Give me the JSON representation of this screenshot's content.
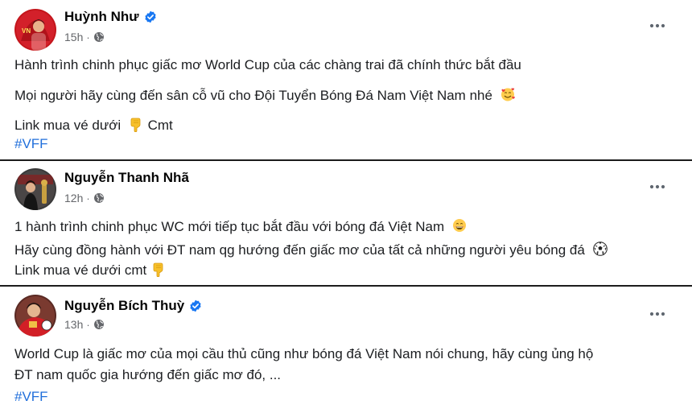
{
  "posts": [
    {
      "author": "Huỳnh Như",
      "verified": true,
      "time": "15h",
      "separator": "·",
      "lines": [
        "Hành trình chinh phục giấc mơ World Cup của các chàng trai đã chính thức bắt đầu",
        "Mọi người hãy cùng đến sân cỗ vũ cho Đội Tuyển Bóng Đá Nam Việt Nam nhé",
        "Link mua vé dưới",
        "Cmt"
      ],
      "hashtag": "#VFF",
      "icons": [
        "avatar",
        "verified-badge-icon",
        "globe-icon",
        "more-options-icon",
        "smiling-face-with-hearts-emoji",
        "pointing-down-hand-emoji"
      ]
    },
    {
      "author": "Nguyễn Thanh Nhã",
      "verified": false,
      "time": "12h",
      "separator": "·",
      "lines": [
        "1 hành trình chinh phục WC mới tiếp tục bắt đầu với bóng đá Việt Nam",
        "Hãy cùng đồng hành với ĐT nam qg hướng đến giấc mơ của tất cả những người yêu bóng đá",
        "Link mua vé dưới cmt"
      ],
      "icons": [
        "avatar",
        "globe-icon",
        "more-options-icon",
        "grinning-face-emoji",
        "soccer-ball-emoji",
        "pointing-down-hand-emoji"
      ]
    },
    {
      "author": "Nguyễn Bích Thuỳ",
      "verified": true,
      "time": "13h",
      "separator": "·",
      "lines": [
        "World Cup là giấc mơ của mọi cầu thủ cũng như bóng đá Việt Nam nói chung, hãy cùng ủng hộ",
        "ĐT nam quốc gia hướng đến giấc mơ đó, ..."
      ],
      "hashtag": "#VFF",
      "icons": [
        "avatar",
        "verified-badge-icon",
        "globe-icon",
        "more-options-icon"
      ]
    }
  ],
  "colors": {
    "author_text": "#050505",
    "meta_text": "#65676b",
    "hashtag": "#216fdb",
    "verified_badge": "#1877f2",
    "divider": "#1c1c1c"
  }
}
